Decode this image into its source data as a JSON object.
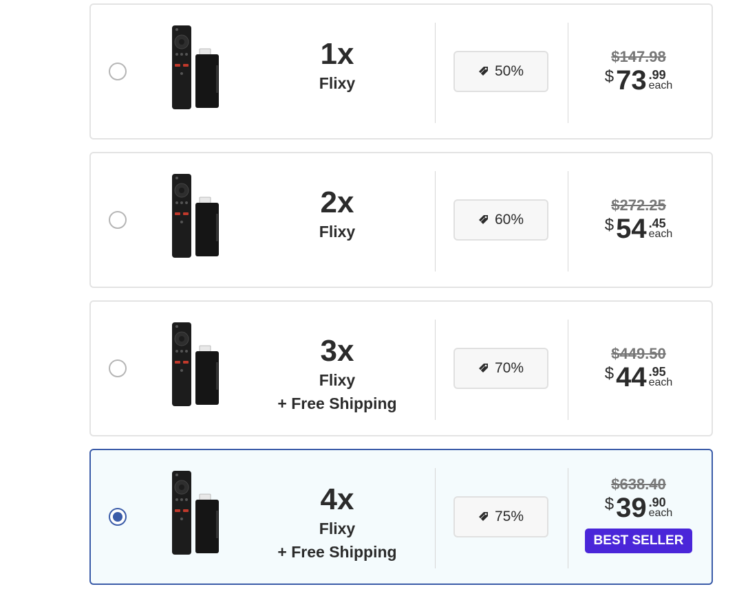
{
  "colors": {
    "accent": "#3a5ba8",
    "best_seller_bg": "#4a26d9",
    "selected_bg": "#f4fbfd"
  },
  "icons": {
    "product": "remote-and-stick-image",
    "discount": "tag-icon"
  },
  "selected_index": 3,
  "offers": [
    {
      "quantity": "1x",
      "name": "Flixy",
      "extra": "",
      "discount": "50%",
      "old_price": "$147.98",
      "currency": "$",
      "price_main": "73",
      "price_cents": ".99",
      "each": "each",
      "badge": ""
    },
    {
      "quantity": "2x",
      "name": "Flixy",
      "extra": "",
      "discount": "60%",
      "old_price": "$272.25",
      "currency": "$",
      "price_main": "54",
      "price_cents": ".45",
      "each": "each",
      "badge": ""
    },
    {
      "quantity": "3x",
      "name": "Flixy",
      "extra": "+ Free Shipping",
      "discount": "70%",
      "old_price": "$449.50",
      "currency": "$",
      "price_main": "44",
      "price_cents": ".95",
      "each": "each",
      "badge": ""
    },
    {
      "quantity": "4x",
      "name": "Flixy",
      "extra": "+ Free Shipping",
      "discount": "75%",
      "old_price": "$638.40",
      "currency": "$",
      "price_main": "39",
      "price_cents": ".90",
      "each": "each",
      "badge": "BEST SELLER"
    }
  ]
}
